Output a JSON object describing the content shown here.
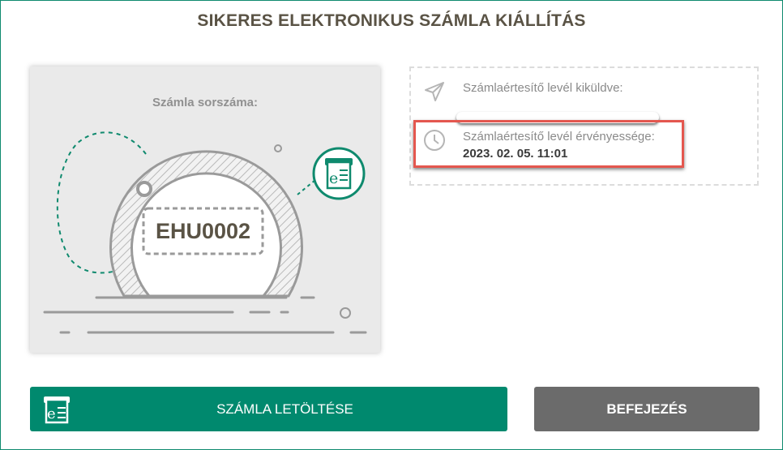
{
  "page": {
    "title": "SIKERES ELEKTRONIKUS SZÁMLA KIÁLLÍTÁS"
  },
  "invoice_card": {
    "label": "Számla sorszáma:",
    "invoice_number": "EHU0002"
  },
  "info_panel": {
    "sent": {
      "label": "Számlaértesítő levél kiküldve:",
      "icon": "paper-plane-icon"
    },
    "validity": {
      "label": "Számlaértesítő levél érvényessége:",
      "value": "2023. 02. 05. 11:01",
      "icon": "clock-icon"
    }
  },
  "buttons": {
    "download_label": "SZÁMLA LETÖLTÉSE",
    "finish_label": "BEFEJEZÉS"
  },
  "colors": {
    "accent": "#00896e",
    "frame": "#0f8a6e",
    "finish_button": "#6b6b6b",
    "highlight": "#e4574f",
    "title_text": "#5a5345"
  }
}
